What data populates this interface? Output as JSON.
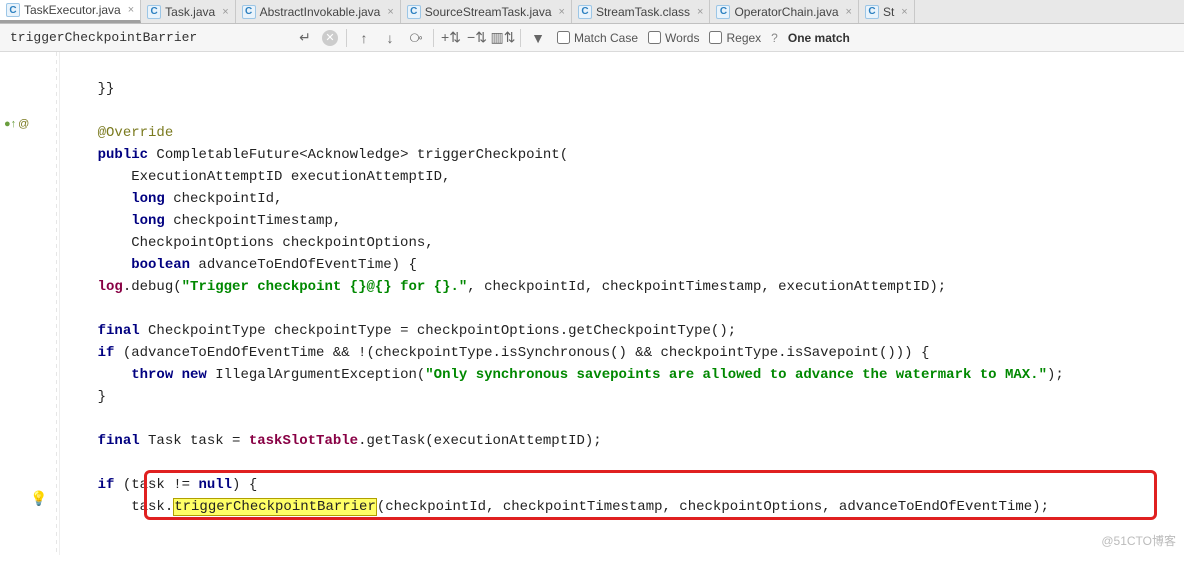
{
  "tabs": [
    {
      "label": "TaskExecutor.java",
      "active": true
    },
    {
      "label": "Task.java",
      "active": false
    },
    {
      "label": "AbstractInvokable.java",
      "active": false
    },
    {
      "label": "SourceStreamTask.java",
      "active": false
    },
    {
      "label": "StreamTask.class",
      "active": false
    },
    {
      "label": "OperatorChain.java",
      "active": false
    },
    {
      "label": "St",
      "active": false
    }
  ],
  "find": {
    "query": "triggerCheckpointBarrier",
    "matchCase": "Match Case",
    "words": "Words",
    "regex": "Regex",
    "help": "?",
    "result": "One match"
  },
  "code": {
    "l0": "    }}",
    "ann": "@Override",
    "l2a": "public",
    "l2b": " CompletableFuture<Acknowledge> triggerCheckpoint(",
    "l3": "        ExecutionAttemptID executionAttemptID,",
    "l4a": "        ",
    "l4kw": "long",
    "l4b": " checkpointId,",
    "l5a": "        ",
    "l5kw": "long",
    "l5b": " checkpointTimestamp,",
    "l6": "        CheckpointOptions checkpointOptions,",
    "l7a": "        ",
    "l7kw": "boolean",
    "l7b": " advanceToEndOfEventTime) {",
    "l8a": "    ",
    "l8f": "log",
    "l8b": ".debug(",
    "l8s": "\"Trigger checkpoint {}@{} for {}.\"",
    "l8c": ", checkpointId, checkpointTimestamp, executionAttemptID);",
    "l10a": "    ",
    "l10kw": "final",
    "l10b": " CheckpointType checkpointType = checkpointOptions.getCheckpointType();",
    "l11a": "    ",
    "l11kw": "if",
    "l11b": " (advanceToEndOfEventTime && !(checkpointType.isSynchronous() && checkpointType.isSavepoint())) {",
    "l12a": "        ",
    "l12kw": "throw new",
    "l12b": " IllegalArgumentException(",
    "l12s": "\"Only synchronous savepoints are allowed to advance the watermark to MAX.\"",
    "l12c": ");",
    "l13": "    }",
    "l15a": "    ",
    "l15kw": "final",
    "l15b": " Task task = ",
    "l15f": "taskSlotTable",
    "l15c": ".getTask(executionAttemptID);",
    "l17a": "    ",
    "l17kw": "if",
    "l17b": " (task != ",
    "l17kw2": "null",
    "l17c": ") {",
    "l18a": "        task.",
    "l18hl": "triggerCheckpointBarrier",
    "l18b": "(checkpointId, checkpointTimestamp, checkpointOptions, advanceToEndOfEventTime);"
  },
  "watermark": "@51CTO博客"
}
